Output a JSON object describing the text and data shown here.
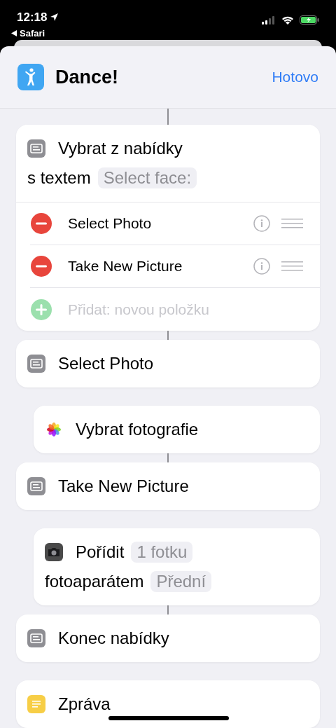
{
  "status_bar": {
    "time": "12:18",
    "back_app": "Safari"
  },
  "header": {
    "title": "Dance!",
    "done": "Hotovo"
  },
  "blocks": [
    {
      "kind": "menu",
      "indented": false,
      "connector_above": true,
      "lines": [
        [
          {
            "kind": "text",
            "text": "Vybrat z nabídky"
          }
        ],
        [
          {
            "kind": "text",
            "text": "s textem"
          },
          {
            "kind": "token",
            "text": "Select face:"
          }
        ]
      ],
      "items": [
        {
          "label": "Select Photo"
        },
        {
          "label": "Take New Picture"
        }
      ],
      "add_placeholder": "Přidat: novou položku"
    },
    {
      "kind": "menu",
      "indented": false,
      "connector_above": true,
      "lines": [
        [
          {
            "kind": "text",
            "text": "Select Photo"
          }
        ]
      ]
    },
    {
      "kind": "photos",
      "indented": true,
      "connector_above": false,
      "lines": [
        [
          {
            "kind": "text",
            "text": "Vybrat fotografie"
          }
        ]
      ]
    },
    {
      "kind": "menu",
      "indented": false,
      "connector_above": true,
      "lines": [
        [
          {
            "kind": "text",
            "text": "Take New Picture"
          }
        ]
      ]
    },
    {
      "kind": "camera",
      "indented": true,
      "connector_above": false,
      "lines": [
        [
          {
            "kind": "text",
            "text": "Pořídit"
          },
          {
            "kind": "token",
            "text": "1 fotku"
          }
        ],
        [
          {
            "kind": "text",
            "text": "fotoaparátem"
          },
          {
            "kind": "token",
            "text": "Přední"
          }
        ]
      ]
    },
    {
      "kind": "menu",
      "indented": false,
      "connector_above": true,
      "lines": [
        [
          {
            "kind": "text",
            "text": "Konec nabídky"
          }
        ]
      ]
    },
    {
      "kind": "notes",
      "indented": false,
      "connector_above": false,
      "lines": [
        [
          {
            "kind": "text",
            "text": "Zpráva"
          }
        ]
      ]
    }
  ]
}
